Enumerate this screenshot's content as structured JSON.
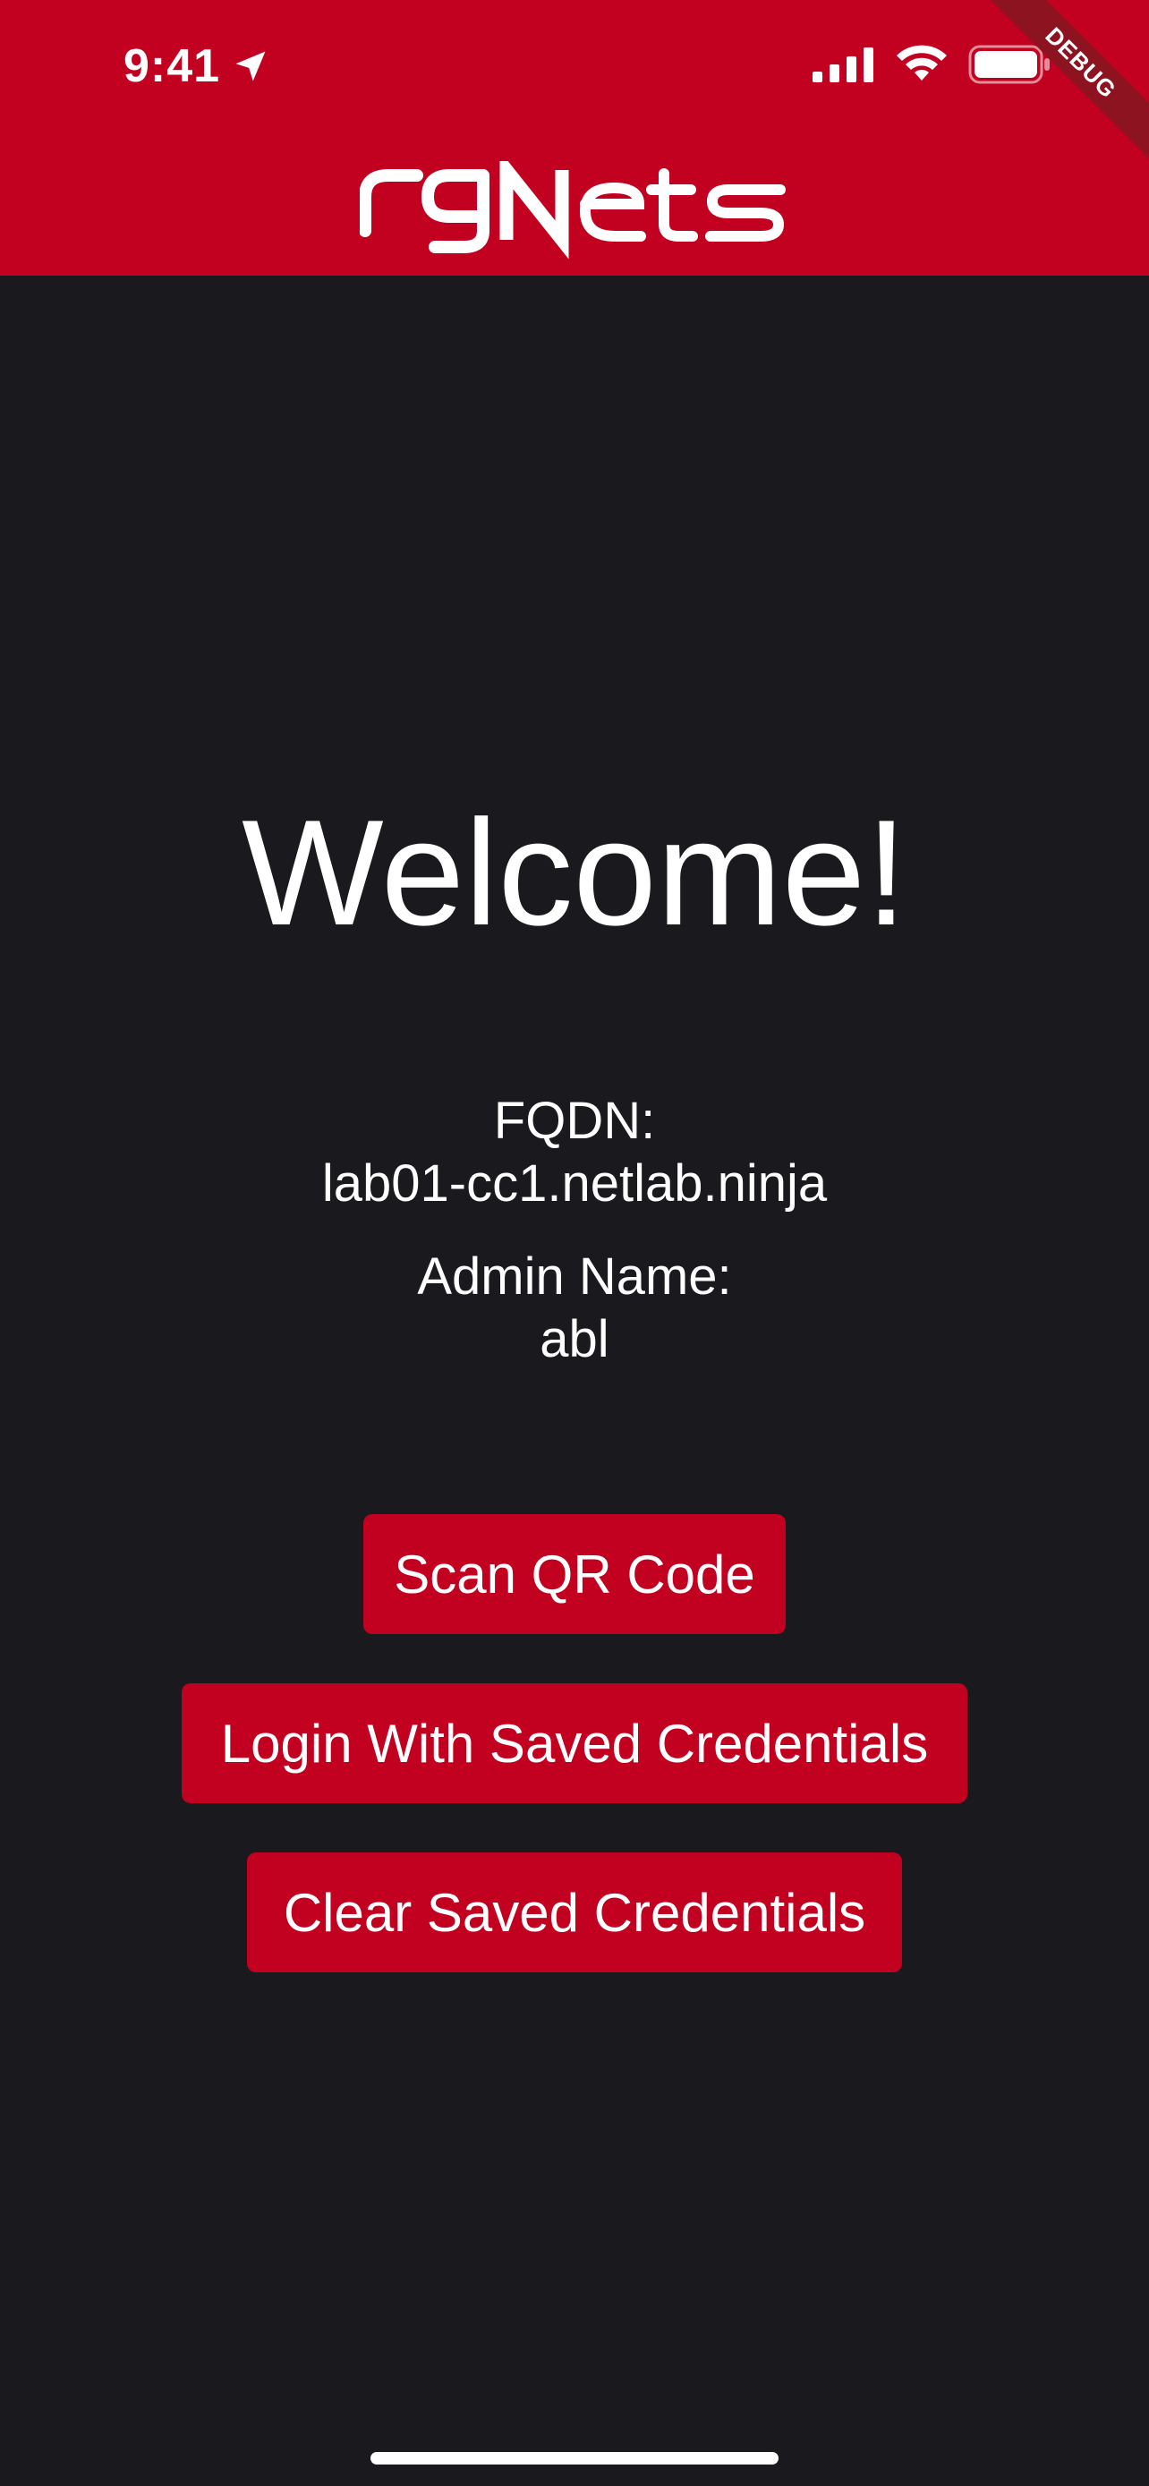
{
  "status_bar": {
    "time": "9:41",
    "icons": [
      "location-arrow-icon",
      "cellular-signal-icon",
      "wifi-icon",
      "battery-icon"
    ]
  },
  "app": {
    "logo_text": "rgNets",
    "debug_banner": "DEBUG"
  },
  "colors": {
    "brand_red": "#c20020",
    "background": "#1a1a1e",
    "text": "#ffffff"
  },
  "main": {
    "title": "Welcome!",
    "fqdn_label": "FQDN:",
    "fqdn_value": "lab01-cc1.netlab.ninja",
    "admin_label": "Admin Name:",
    "admin_value": "abl"
  },
  "actions": {
    "scan_label": "Scan QR Code",
    "login_label": "Login With Saved Credentials",
    "clear_label": "Clear Saved Credentials"
  }
}
